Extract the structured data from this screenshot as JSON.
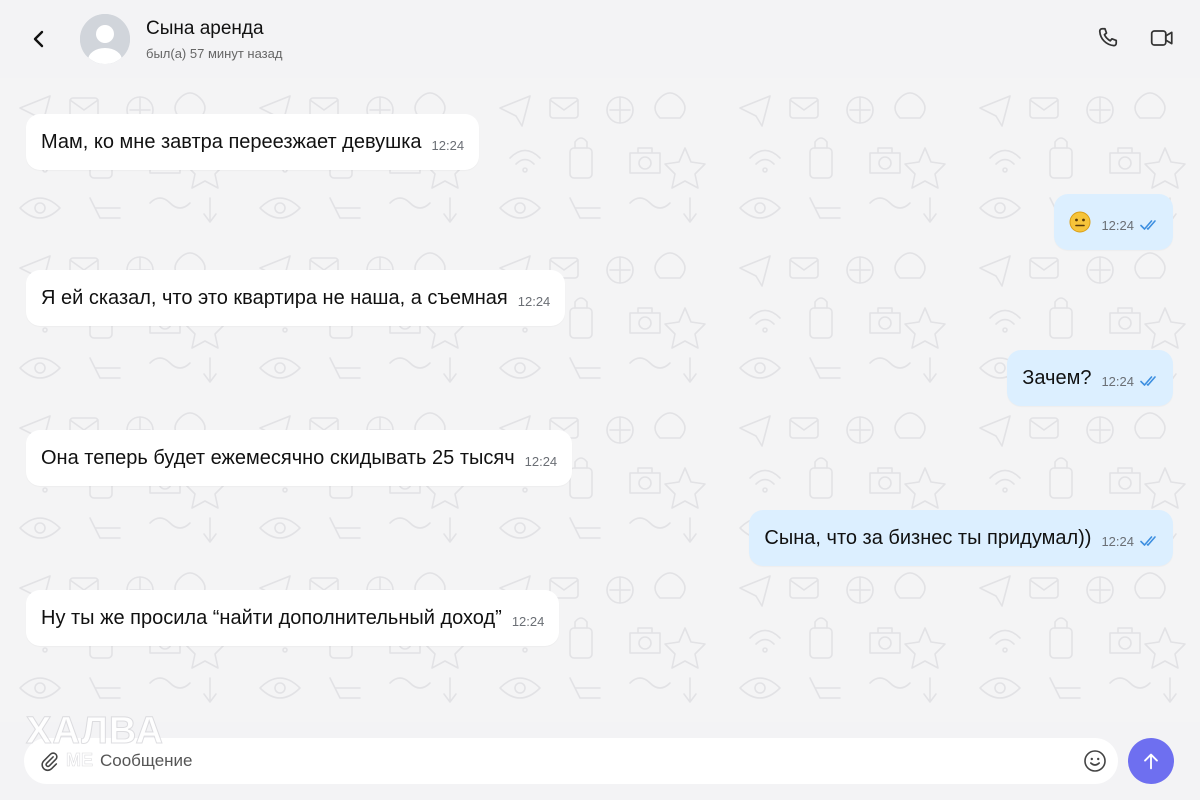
{
  "header": {
    "title": "Сына аренда",
    "status": "был(а) 57 минут назад"
  },
  "messages": [
    {
      "direction": "in",
      "text": "Мам, ко мне завтра переезжает девушка",
      "time": "12:24"
    },
    {
      "direction": "out",
      "text": "",
      "emoji": "neutral-face-emoji",
      "time": "12:24",
      "read": true
    },
    {
      "direction": "in",
      "text": "Я ей сказал, что это квартира не наша, а съемная",
      "time": "12:24"
    },
    {
      "direction": "out",
      "text": "Зачем?",
      "time": "12:24",
      "read": true
    },
    {
      "direction": "in",
      "text": "Она теперь будет ежемесячно скидывать 25 тысяч",
      "time": "12:24"
    },
    {
      "direction": "out",
      "text": "Сына, что за бизнес ты придумал))",
      "time": "12:24",
      "read": true
    },
    {
      "direction": "in",
      "text": "Ну ты же просила “найти дополнительный доход”",
      "time": "12:24"
    }
  ],
  "composer": {
    "placeholder": "Сообщение"
  },
  "watermark": {
    "line1": "ХАЛВА",
    "line2": "МЕ"
  },
  "colors": {
    "outgoing_bubble": "#dcefff",
    "incoming_bubble": "#ffffff",
    "send_button": "#6e6ff0",
    "read_ticks": "#3d8fe0"
  }
}
